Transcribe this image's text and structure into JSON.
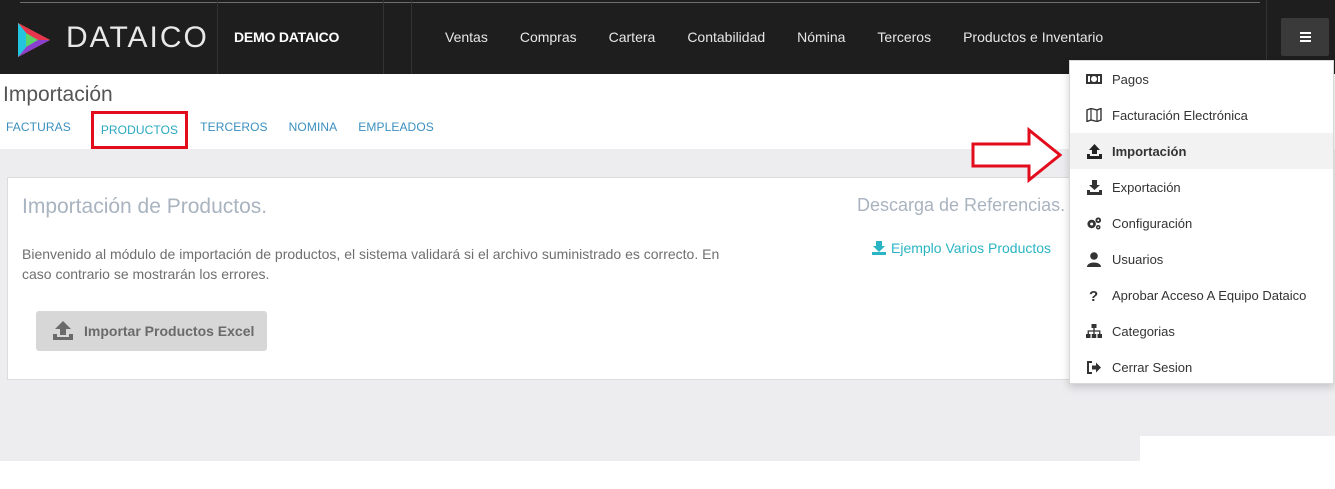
{
  "brand": {
    "name": "DATAICO"
  },
  "company": {
    "name": "DEMO DATAICO"
  },
  "nav": {
    "items": [
      "Ventas",
      "Compras",
      "Cartera",
      "Contabilidad",
      "Nómina",
      "Terceros",
      "Productos e Inventario"
    ]
  },
  "page": {
    "title": "Importación",
    "tabs": [
      "FACTURAS",
      "PRODUCTOS",
      "TERCEROS",
      "NOMINA",
      "EMPLEADOS"
    ],
    "active_tab": "PRODUCTOS"
  },
  "card": {
    "title": "Importación de Productos.",
    "text": "Bienvenido al módulo de importación de productos, el sistema validará si el archivo suministrado es correcto. En caso contrario se mostrarán los errores.",
    "button_label": "Importar Productos Excel",
    "ref_title": "Descarga de Referencias.",
    "ref_link": "Ejemplo Varios Productos"
  },
  "dropdown": {
    "items": [
      {
        "label": "Pagos",
        "icon": "money-icon"
      },
      {
        "label": "Facturación Electrónica",
        "icon": "map-icon"
      },
      {
        "label": "Importación",
        "icon": "upload-icon",
        "active": true
      },
      {
        "label": "Exportación",
        "icon": "download-icon"
      },
      {
        "label": "Configuración",
        "icon": "gears-icon"
      },
      {
        "label": "Usuarios",
        "icon": "user-icon"
      },
      {
        "label": "Aprobar Acceso A Equipo Dataico",
        "icon": "question-icon"
      },
      {
        "label": "Categorias",
        "icon": "sitemap-icon"
      },
      {
        "label": "Cerrar Sesion",
        "icon": "sign-out-icon"
      }
    ]
  },
  "colors": {
    "topbar": "#1e1e1e",
    "link": "#3a8fbf",
    "accent": "#2bb5c4",
    "highlight": "#e30c1c"
  }
}
